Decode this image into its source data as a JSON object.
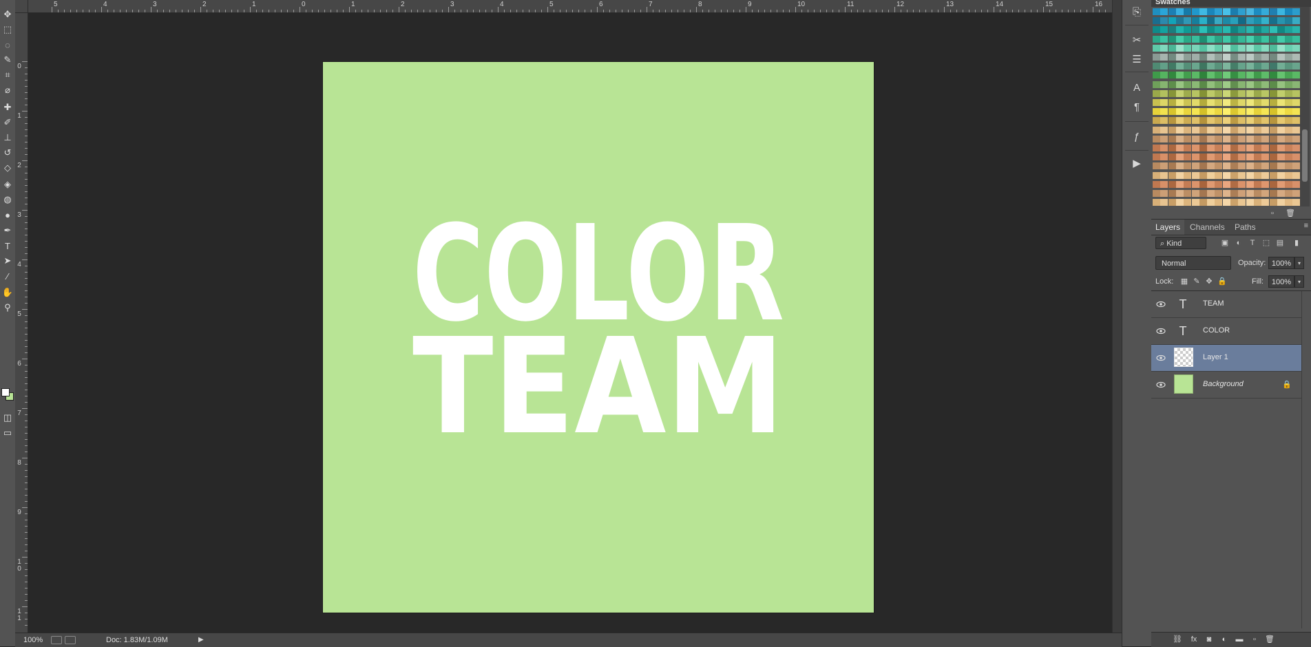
{
  "app": {
    "accent_canvas_color": "#b8e495",
    "artwork_text_color": "#ffffff",
    "selected_layer_color": "#6a7d9c"
  },
  "toolbar": {
    "tools": [
      {
        "name": "move-tool-icon",
        "glyph": "✥"
      },
      {
        "name": "marquee-tool-icon",
        "glyph": "⬚"
      },
      {
        "name": "lasso-tool-icon",
        "glyph": "◌"
      },
      {
        "name": "quick-select-tool-icon",
        "glyph": "✎"
      },
      {
        "name": "crop-tool-icon",
        "glyph": "⌗"
      },
      {
        "name": "eyedropper-tool-icon",
        "glyph": "⌀"
      },
      {
        "name": "healing-brush-tool-icon",
        "glyph": "✚"
      },
      {
        "name": "brush-tool-icon",
        "glyph": "✐"
      },
      {
        "name": "clone-stamp-tool-icon",
        "glyph": "⊥"
      },
      {
        "name": "history-brush-tool-icon",
        "glyph": "↺"
      },
      {
        "name": "eraser-tool-icon",
        "glyph": "◇"
      },
      {
        "name": "paint-bucket-tool-icon",
        "glyph": "◈"
      },
      {
        "name": "blur-tool-icon",
        "glyph": "◍"
      },
      {
        "name": "dodge-tool-icon",
        "glyph": "●"
      },
      {
        "name": "pen-tool-icon",
        "glyph": "✒"
      },
      {
        "name": "type-tool-icon",
        "glyph": "T"
      },
      {
        "name": "path-select-tool-icon",
        "glyph": "➤"
      },
      {
        "name": "line-tool-icon",
        "glyph": "∕"
      },
      {
        "name": "hand-tool-icon",
        "glyph": "✋"
      },
      {
        "name": "zoom-tool-icon",
        "glyph": "⚲"
      }
    ]
  },
  "rulers": {
    "top_labels": [
      "5",
      "4",
      "3",
      "2",
      "1",
      "0",
      "1",
      "2",
      "3",
      "4",
      "5",
      "6",
      "7",
      "8",
      "9",
      "10",
      "11",
      "12",
      "13",
      "14",
      "15",
      "16"
    ],
    "left_labels": [
      "0",
      "1",
      "2",
      "3",
      "4",
      "5",
      "6",
      "7",
      "8",
      "9",
      "10",
      "11"
    ]
  },
  "artwork": {
    "line1": "COLOR",
    "line2": "TEAM"
  },
  "statusbar": {
    "zoom": "100%",
    "doc_size": "Doc: 1.83M/1.09M"
  },
  "iconstrip": [
    {
      "name": "history-panel-icon",
      "glyph": "⎘"
    },
    {
      "name": "brush-presets-panel-icon",
      "glyph": "✂"
    },
    {
      "name": "adjustments-panel-icon",
      "glyph": "☰"
    },
    {
      "name": "character-panel-icon",
      "glyph": "A"
    },
    {
      "name": "paragraph-panel-icon",
      "glyph": "¶"
    },
    {
      "name": "styles-panel-icon",
      "glyph": "ƒ"
    },
    {
      "name": "actions-panel-icon",
      "glyph": "▶"
    }
  ],
  "swatches": {
    "title": "Swatches"
  },
  "layers_panel": {
    "tabs": [
      "Layers",
      "Channels",
      "Paths"
    ],
    "kind_label": "⌕ Kind",
    "blend_mode": "Normal",
    "opacity_label": "Opacity:",
    "opacity_value": "100%",
    "lock_label": "Lock:",
    "fill_label": "Fill:",
    "fill_value": "100%",
    "layers": [
      {
        "name": "TEAM",
        "type": "text",
        "visible": true,
        "selected": false
      },
      {
        "name": "COLOR",
        "type": "text",
        "visible": true,
        "selected": false
      },
      {
        "name": "Layer 1",
        "type": "raster",
        "visible": true,
        "selected": true
      },
      {
        "name": "Background",
        "type": "background",
        "visible": true,
        "selected": false,
        "locked": true
      }
    ]
  }
}
